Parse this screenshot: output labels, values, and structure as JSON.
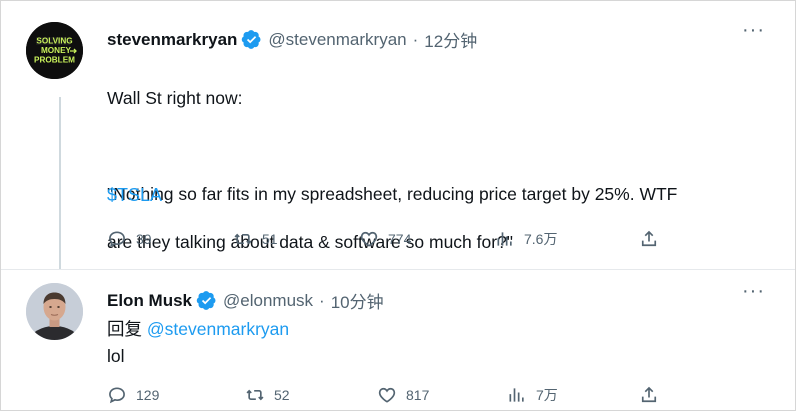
{
  "tweets": [
    {
      "author": "stevenmarkryan",
      "handle": "@stevenmarkryan",
      "separator": "·",
      "time": "12分钟",
      "avatar_text": [
        "SOLVING",
        "MONEY",
        "PROBLEM"
      ],
      "text_lines": [
        "Wall St right now:",
        "",
        "\"Nothing so far fits in my spreadsheet, reducing price target by 25%. WTF",
        "are they talking about data & software so much for?\""
      ],
      "cashtag": "$TSLA",
      "stats": {
        "replies": "39",
        "retweets": "51",
        "likes": "774",
        "views": "7.6万"
      }
    },
    {
      "author": "Elon Musk",
      "handle": "@elonmusk",
      "separator": "·",
      "time": "10分钟",
      "reply_prefix": "回复",
      "reply_mention": "@stevenmarkryan",
      "text": "lol",
      "stats": {
        "replies": "129",
        "retweets": "52",
        "likes": "817",
        "views": "7万"
      }
    }
  ],
  "more_icon": "···",
  "colors": {
    "accent": "#1d9bf0",
    "muted": "#536471",
    "text": "#0f1419"
  }
}
